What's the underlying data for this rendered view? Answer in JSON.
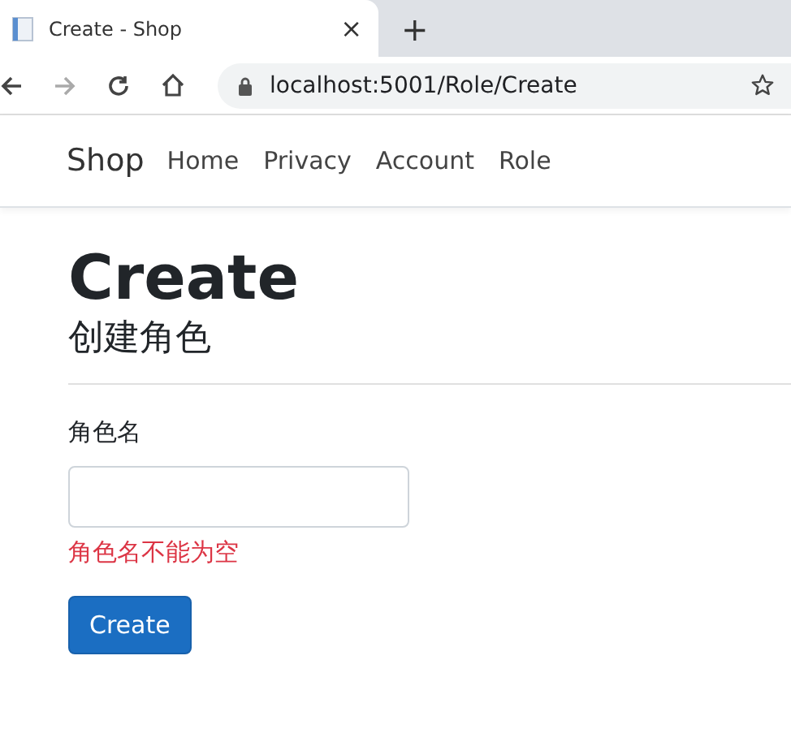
{
  "browser": {
    "tab_title": "Create - Shop",
    "close": "×",
    "new_tab": "+",
    "url": "localhost:5001/Role/Create"
  },
  "navbar": {
    "brand": "Shop",
    "links": [
      "Home",
      "Privacy",
      "Account",
      "Role"
    ]
  },
  "page": {
    "title": "Create",
    "subtitle": "创建角色",
    "form": {
      "label": "角色名",
      "error": "角色名不能为空",
      "submit": "Create"
    }
  }
}
